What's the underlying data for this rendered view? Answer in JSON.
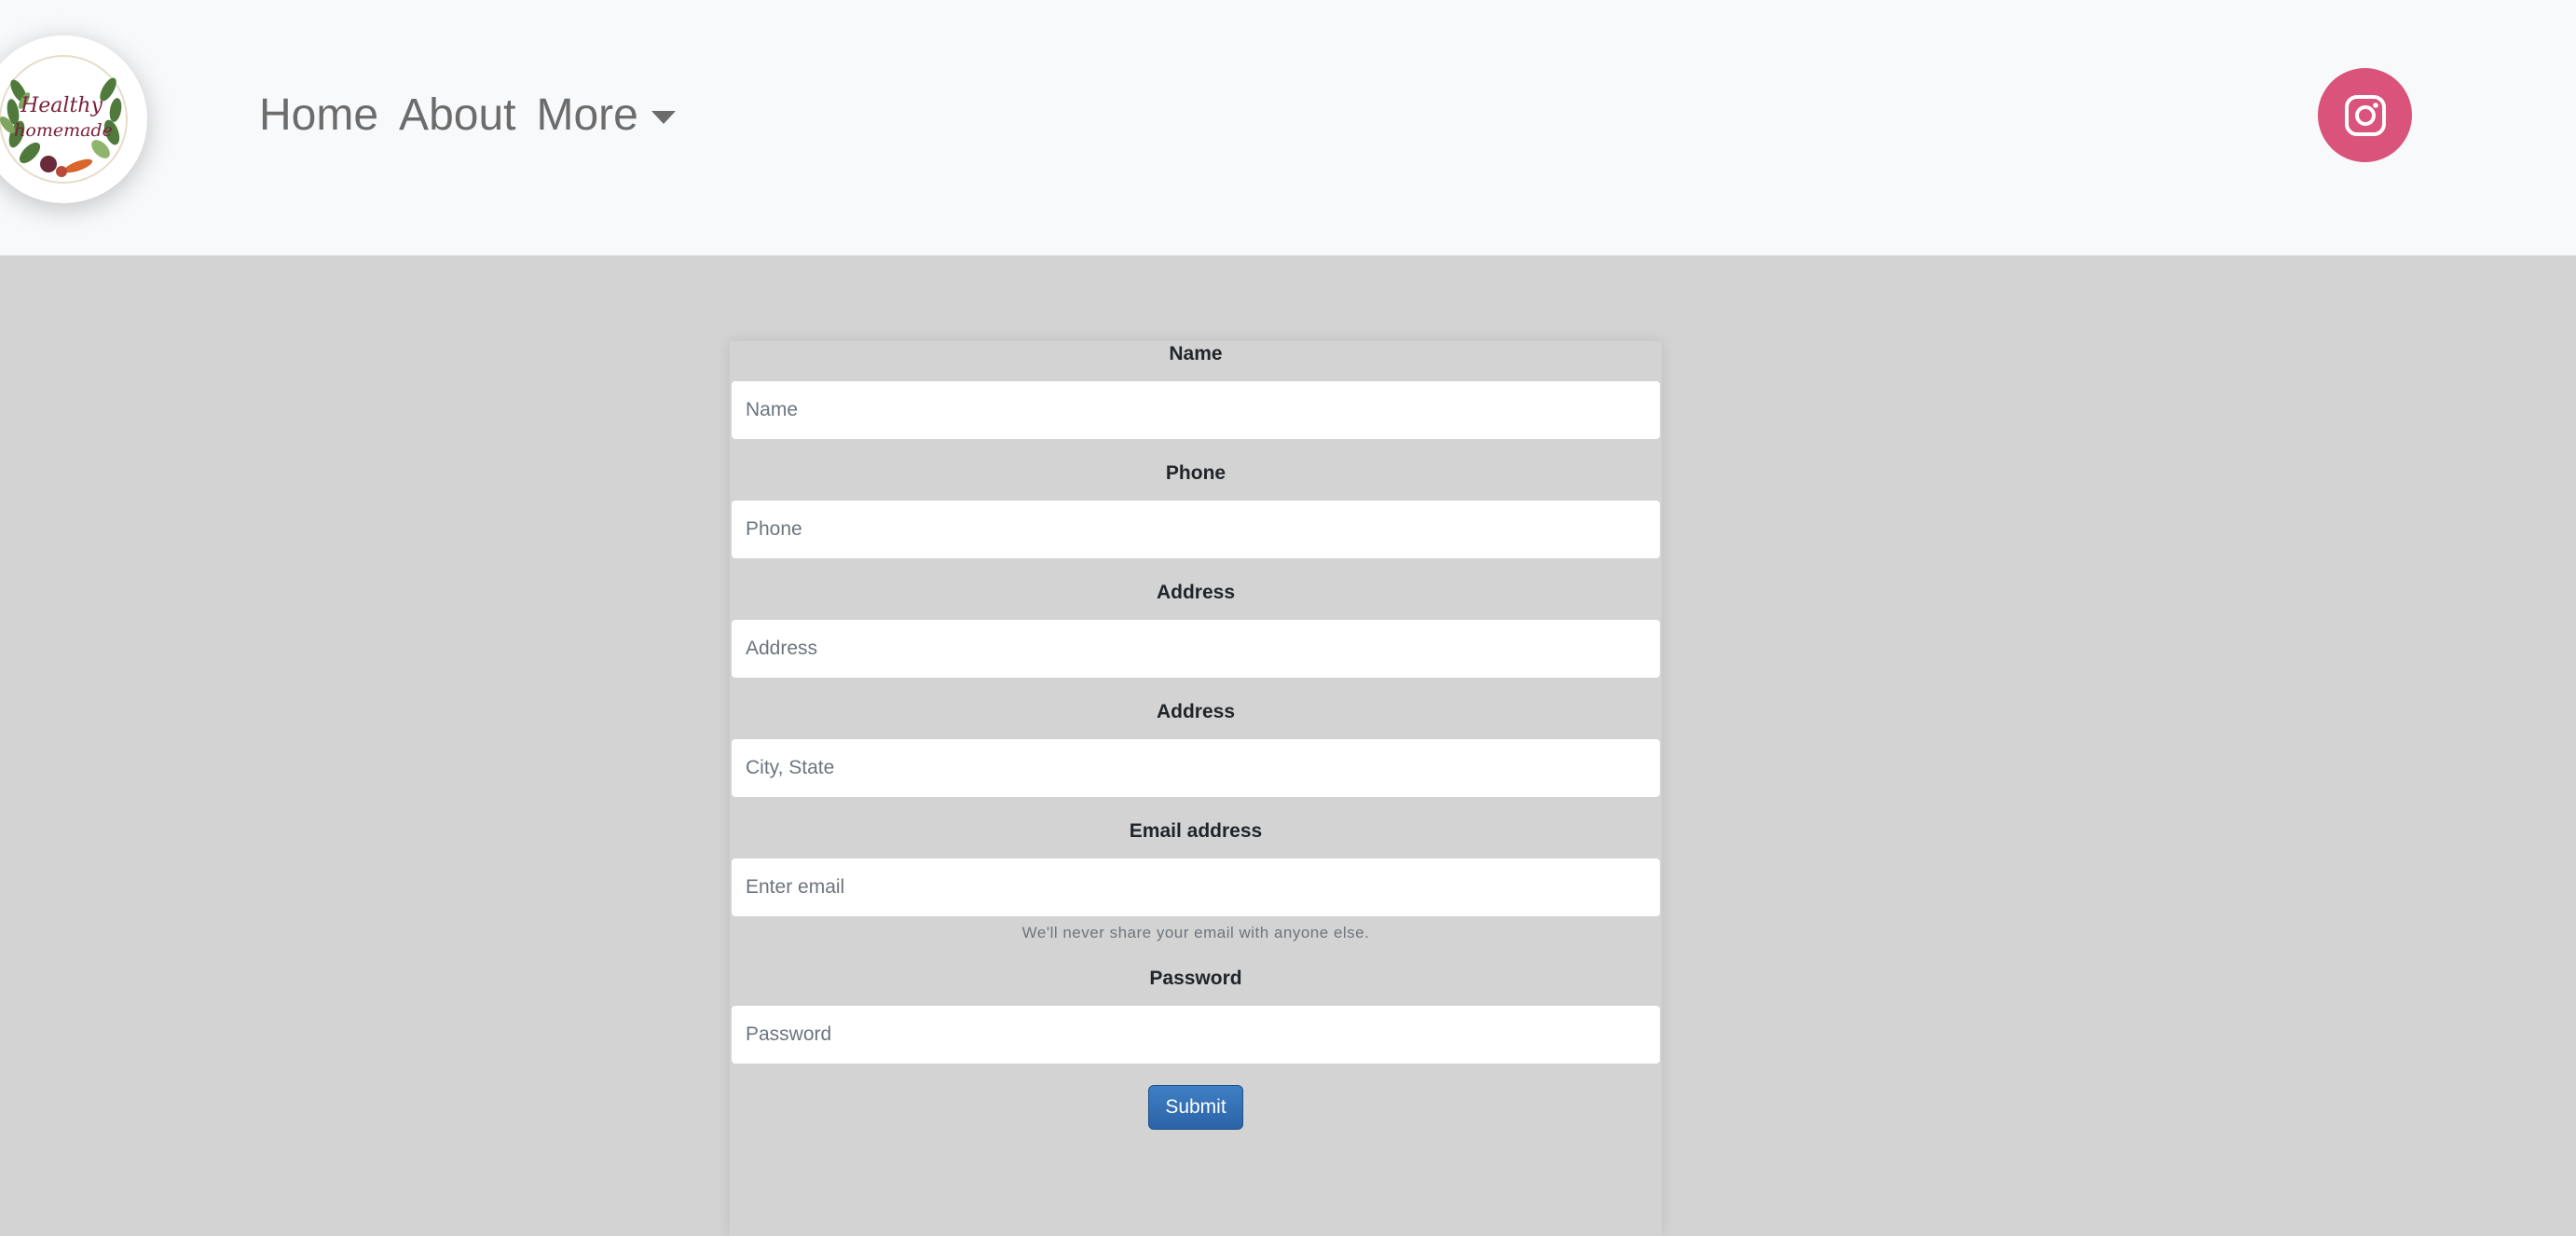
{
  "navbar": {
    "logo": {
      "text_line1": "Healthy",
      "text_line2": "homemade",
      "icon": "healthy-homemade-logo"
    },
    "links": [
      {
        "label": "Home"
      },
      {
        "label": "About"
      },
      {
        "label": "More"
      }
    ],
    "social": {
      "icon": "instagram-icon",
      "color": "#d9537a"
    }
  },
  "form": {
    "fields": [
      {
        "label": "Name",
        "placeholder": "Name",
        "value": ""
      },
      {
        "label": "Phone",
        "placeholder": "Phone",
        "value": ""
      },
      {
        "label": "Address",
        "placeholder": "Address",
        "value": ""
      },
      {
        "label": "Address",
        "placeholder": "City, State",
        "value": ""
      },
      {
        "label": "Email address",
        "placeholder": "Enter email",
        "value": ""
      },
      {
        "label": "Password",
        "placeholder": "Password",
        "value": ""
      }
    ],
    "email_help": "We'll never share your email with anyone else.",
    "submit_label": "Submit"
  },
  "colors": {
    "navbar_bg": "#f8f9fa",
    "page_bg": "#d3d3d3",
    "submit_bg": "#3572b8",
    "instagram": "#d9537a"
  }
}
